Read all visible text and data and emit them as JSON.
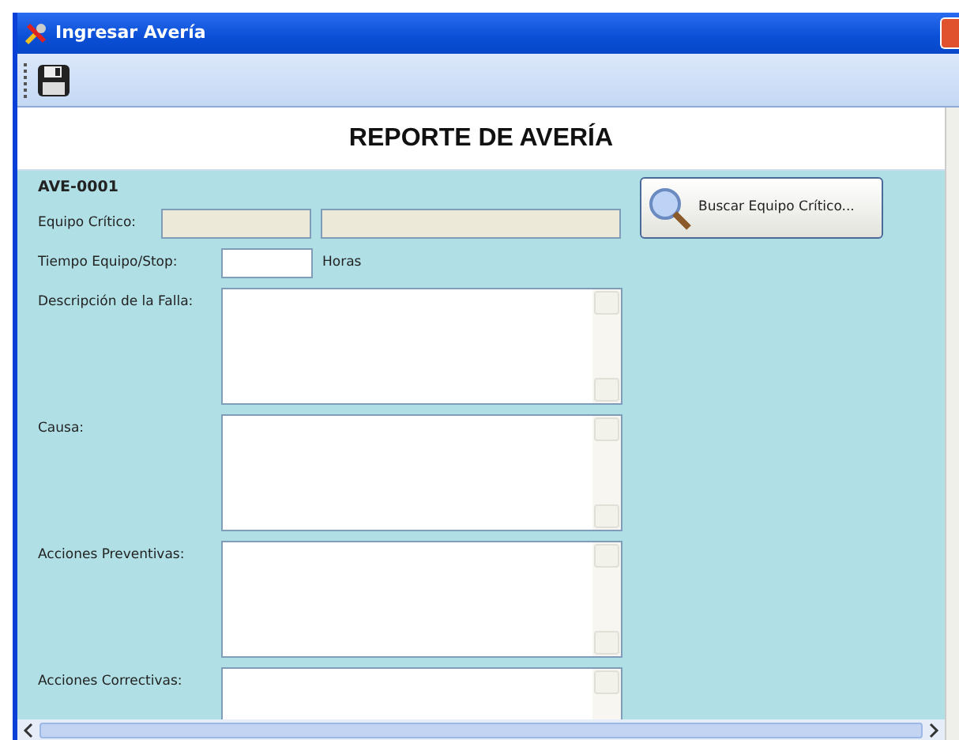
{
  "window": {
    "title": "Ingresar Avería"
  },
  "heading": "REPORTE DE AVERÍA",
  "record_code": "AVE-0001",
  "fields": [
    {
      "kind": "pair",
      "label": "Equipo Crítico:",
      "disabled": true
    },
    {
      "kind": "hours",
      "label": "Tiempo Equipo/Stop:",
      "unit": "Horas"
    },
    {
      "kind": "memo",
      "label": "Descripción de la Falla:"
    },
    {
      "kind": "memo",
      "label": "Causa:"
    },
    {
      "kind": "memo",
      "label": "Acciones Preventivas:"
    },
    {
      "kind": "memo",
      "label": "Acciones Correctivas:"
    }
  ],
  "search_button": {
    "label": "Buscar Equipo Crítico..."
  }
}
